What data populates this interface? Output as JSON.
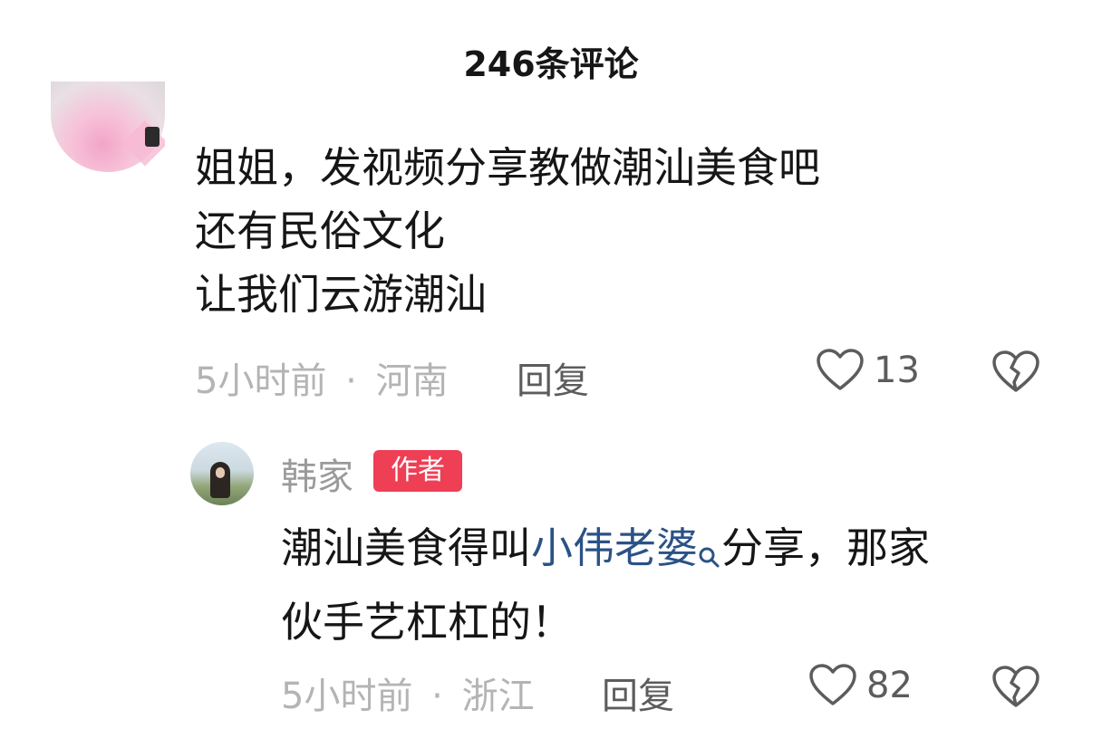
{
  "header": {
    "title": "246条评论"
  },
  "comment": {
    "lines": [
      "姐姐，发视频分享教做潮汕美食吧",
      "还有民俗文化",
      "让我们云游潮汕"
    ],
    "time": "5小时前",
    "separator": "·",
    "location": "河南",
    "reply_label": "回复",
    "likes": "13",
    "like_icon": "heart-outline",
    "dislike_icon": "broken-heart-outline"
  },
  "reply": {
    "author": "韩家",
    "badge": "作者",
    "badge_color": "#ee3f55",
    "line1_before": "潮汕美食得叫",
    "mention": "小伟老婆",
    "mention_icon": "search-icon",
    "mention_color": "#2b5286",
    "line1_after": "分享，那家",
    "line2": "伙手艺杠杠的！",
    "time": "5小时前",
    "separator": "·",
    "location": "浙江",
    "reply_label": "回复",
    "likes": "82"
  }
}
